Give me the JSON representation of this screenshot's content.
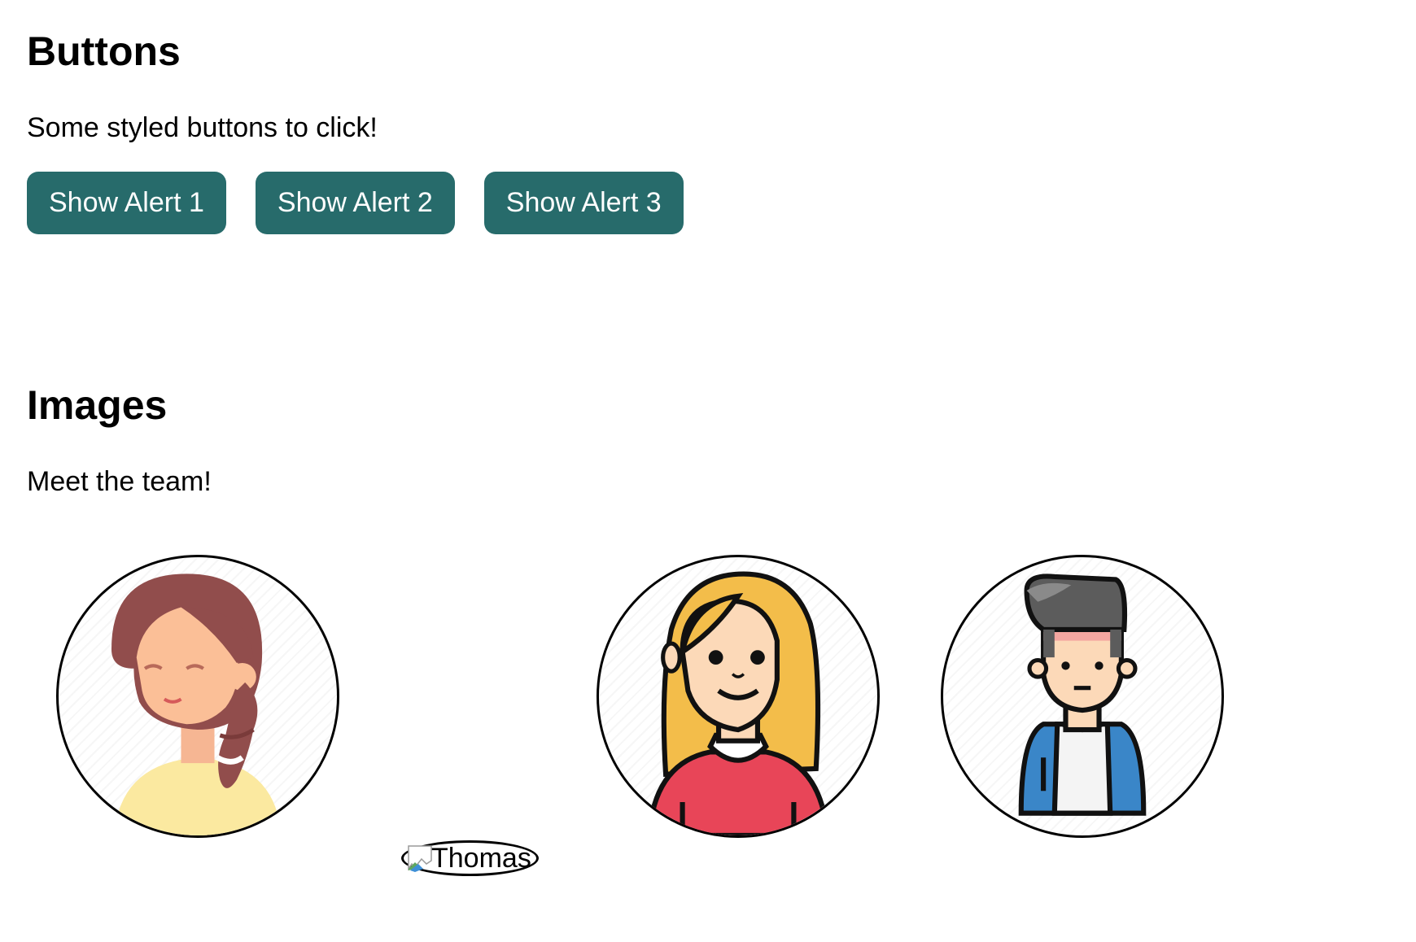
{
  "sections": {
    "buttons": {
      "title": "Buttons",
      "description": "Some styled buttons to click!",
      "items": [
        "Show Alert 1",
        "Show Alert 2",
        "Show Alert 3"
      ]
    },
    "images": {
      "title": "Images",
      "description": "Meet the team!",
      "broken_alt": "Thomas"
    }
  },
  "colors": {
    "button_bg": "#276b6b",
    "button_text": "#ffffff"
  },
  "icons": {
    "avatar_1": "woman-braid-avatar-icon",
    "avatar_2": "broken-image-icon",
    "avatar_3": "blonde-woman-avatar-icon",
    "avatar_4": "man-jacket-avatar-icon"
  }
}
